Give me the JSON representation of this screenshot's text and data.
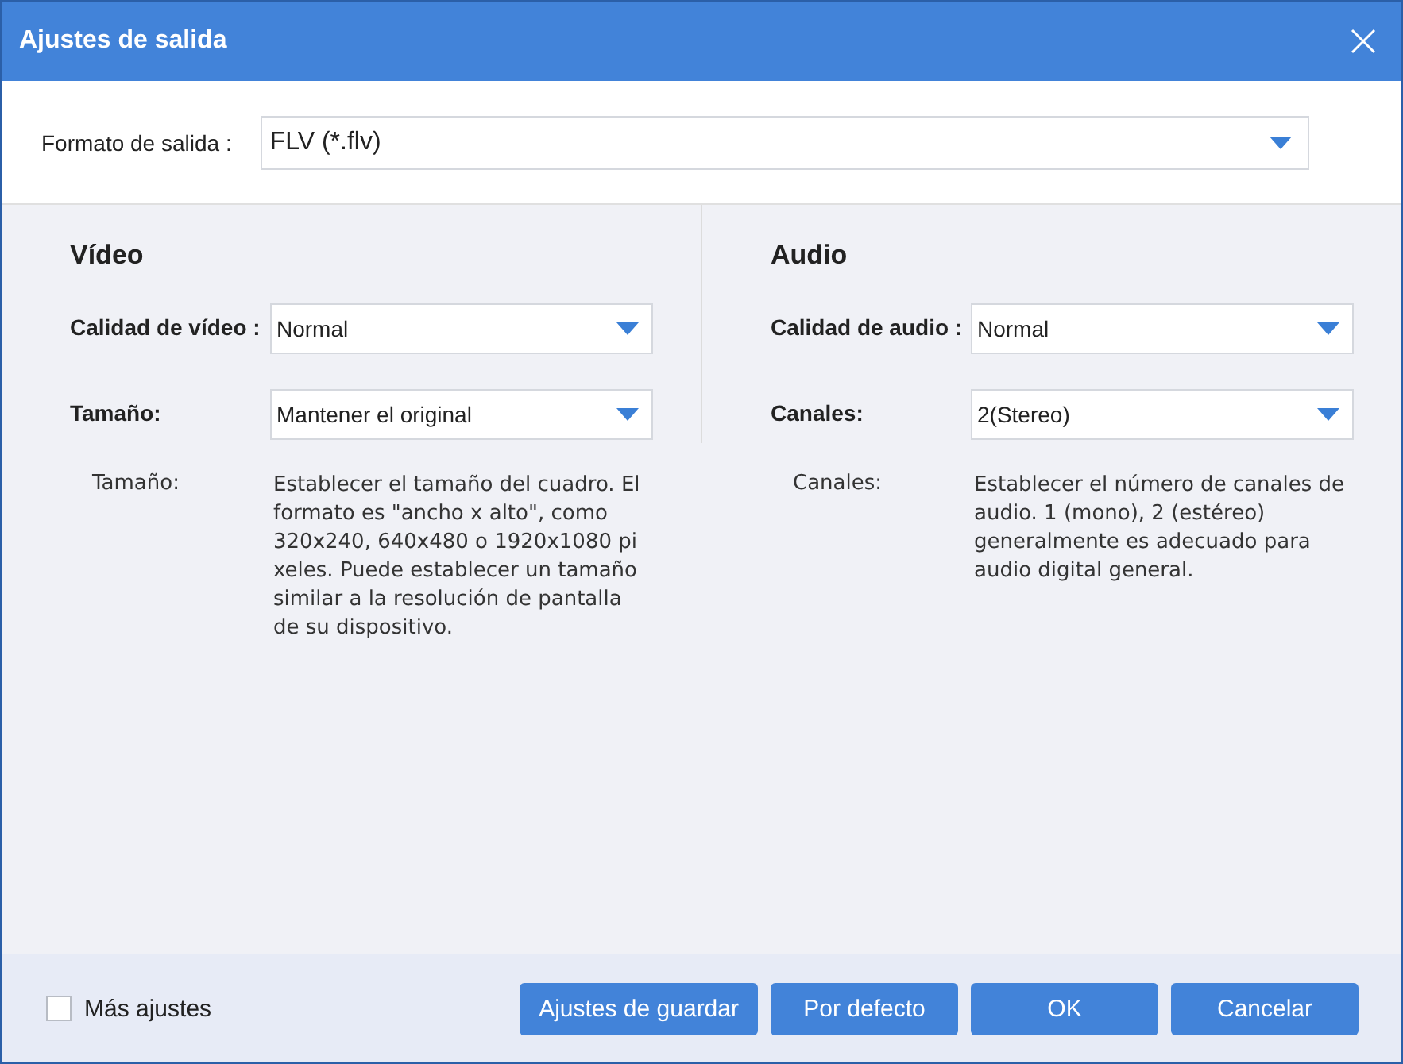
{
  "window": {
    "title": "Ajustes de salida"
  },
  "output_format": {
    "label": "Formato de salida :",
    "value": "FLV (*.flv)"
  },
  "panels": [
    {
      "title": "Vídeo",
      "fields": [
        {
          "label": "Calidad de vídeo :",
          "value": "Normal"
        },
        {
          "label": "Tamaño:",
          "value": "Mantener el original"
        }
      ],
      "help": {
        "label": "Tamaño:",
        "text": "Establecer el tamaño del cuadro. El formato es \"ancho x alto\", como 320x240, 640x480 o 1920x1080 pi xeles. Puede establecer un tamaño similar a la resolución de pantalla de su dispositivo."
      }
    },
    {
      "title": "Audio",
      "fields": [
        {
          "label": "Calidad de audio :",
          "value": "Normal"
        },
        {
          "label": "Canales:",
          "value": "2(Stereo)"
        }
      ],
      "help": {
        "label": "Canales:",
        "text": "Establecer el número de canales de audio. 1 (mono), 2 (estéreo) generalmente es adecuado para audio digital general."
      }
    }
  ],
  "more_settings": {
    "label": "Más ajustes",
    "checked": false
  },
  "buttons": [
    "Ajustes de guardar",
    "Por defecto",
    "OK",
    "Cancelar"
  ]
}
